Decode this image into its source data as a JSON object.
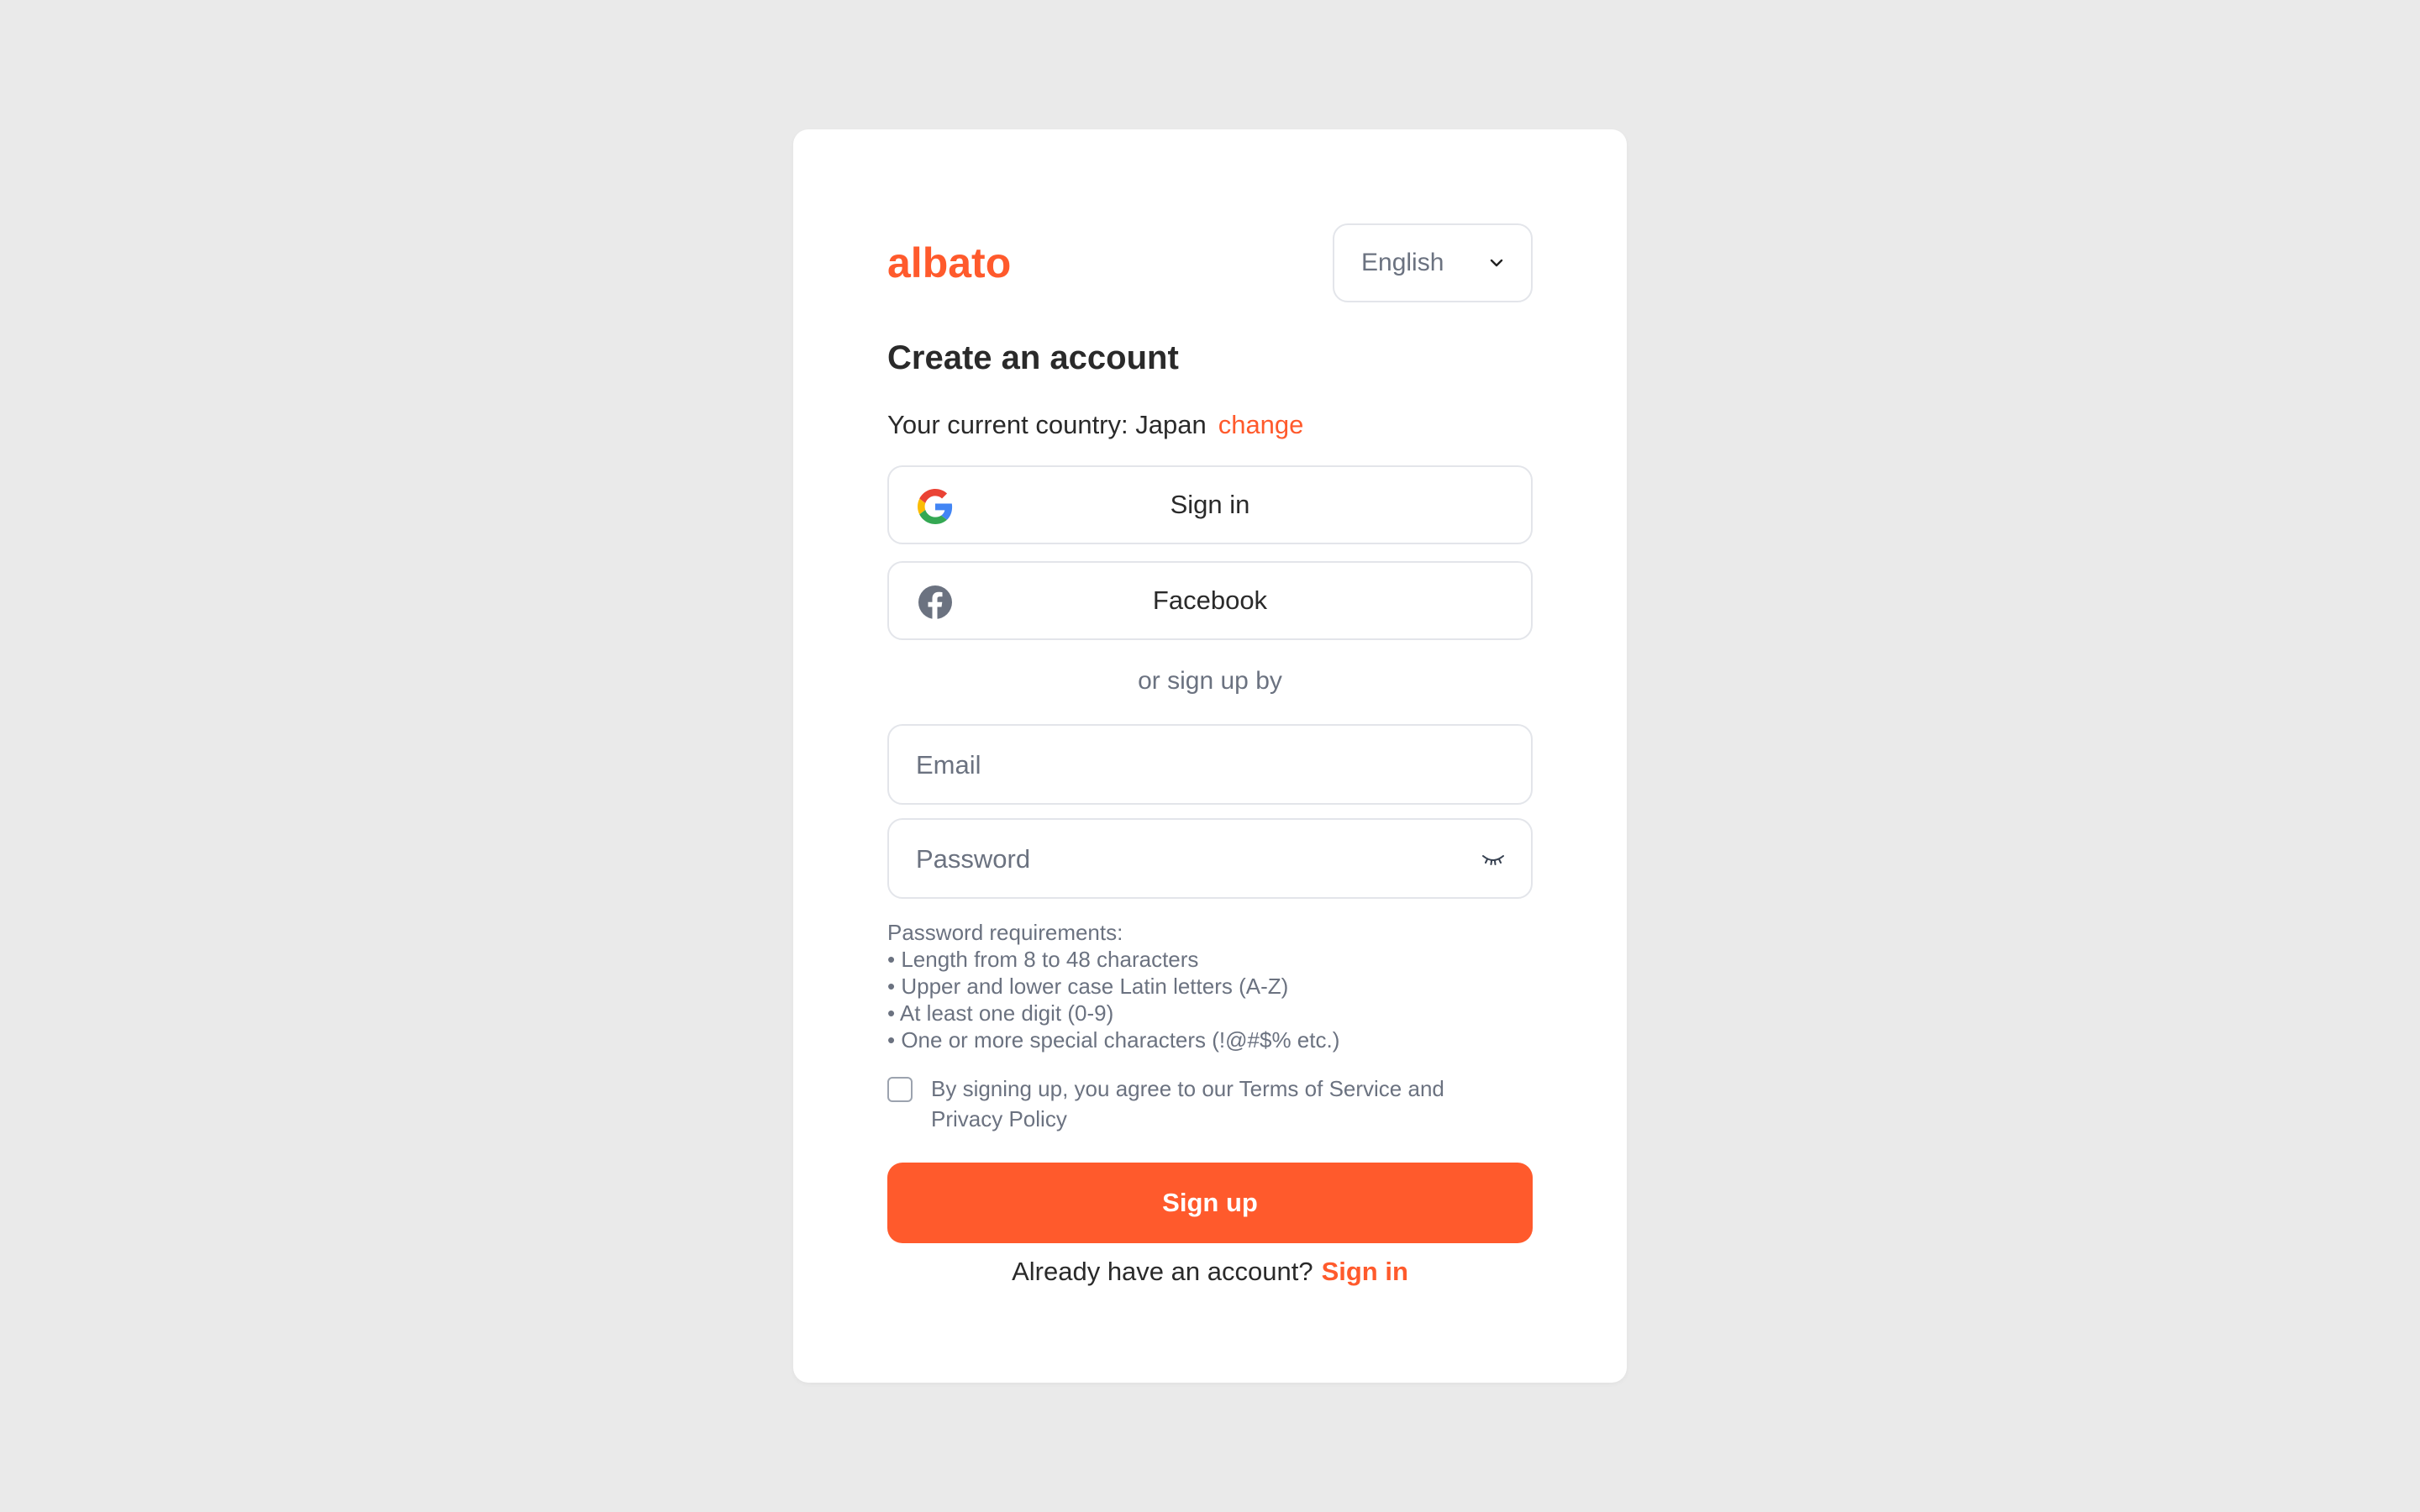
{
  "brand": {
    "logo_text": "albato",
    "color": "#ff5a2c"
  },
  "language": {
    "selected": "English",
    "icon": "chevron-down-icon"
  },
  "form": {
    "title": "Create an account",
    "country_label": "Your current country: Japan",
    "country_change": "change",
    "google_label": "Sign in",
    "facebook_label": "Facebook",
    "divider": "or sign up by",
    "email_placeholder": "Email",
    "email_value": "",
    "password_placeholder": "Password",
    "password_value": "",
    "requirements": [
      "Password requirements:",
      "• Length from 8 to 48 characters",
      "• Upper and lower case Latin letters (A-Z)",
      "• At least one digit (0-9)",
      "• One or more special characters (!@#$% etc.)"
    ],
    "agree_prefix": "By signing up, you agree to our ",
    "terms_link": "Terms of Service",
    "agree_and": " and ",
    "privacy_link": "Privacy Policy",
    "agree_checked": false,
    "signup_button": "Sign up",
    "already_text": "Already have an account?",
    "signin_link": "Sign in"
  }
}
